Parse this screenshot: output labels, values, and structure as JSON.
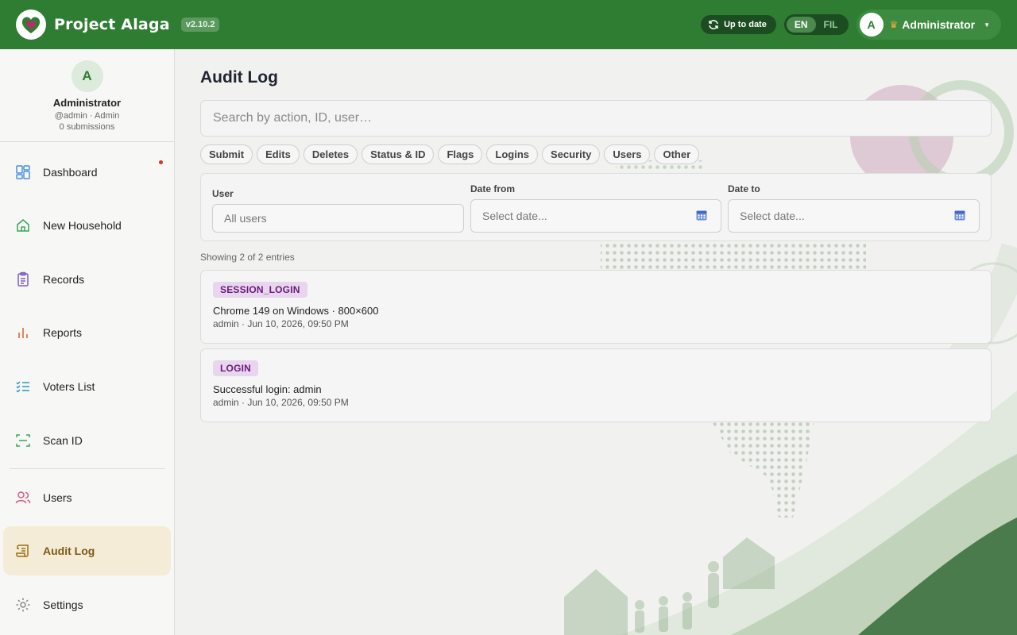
{
  "header": {
    "brand": "Project Alaga",
    "version": "v2.10.2",
    "sync_status": "Up to date",
    "lang_active": "EN",
    "lang_inactive": "FIL",
    "user_initial": "A",
    "user_name": "Administrator"
  },
  "sidebar": {
    "profile": {
      "initial": "A",
      "name": "Administrator",
      "handle": "@admin · Admin",
      "submissions": "0 submissions"
    },
    "items": [
      {
        "label": "Dashboard",
        "icon": "dashboard-icon",
        "color": "#4a90e2"
      },
      {
        "label": "New Household",
        "icon": "home-icon",
        "color": "#3aa65a"
      },
      {
        "label": "Records",
        "icon": "clipboard-icon",
        "color": "#7b5fc9"
      },
      {
        "label": "Reports",
        "icon": "bar-chart-icon",
        "color": "#e07a4d"
      },
      {
        "label": "Voters List",
        "icon": "checklist-icon",
        "color": "#2b9ab5"
      },
      {
        "label": "Scan ID",
        "icon": "scan-icon",
        "color": "#3aa65a"
      },
      {
        "label": "Users",
        "icon": "users-icon",
        "color": "#d9598a"
      },
      {
        "label": "Audit Log",
        "icon": "scroll-icon",
        "color": "#9a6d12"
      },
      {
        "label": "Settings",
        "icon": "gear-icon",
        "color": "#888888"
      }
    ],
    "active": "Audit Log"
  },
  "main": {
    "title": "Audit Log",
    "search_placeholder": "Search by action, ID, user…",
    "chips": [
      "Submit",
      "Edits",
      "Deletes",
      "Status & ID",
      "Flags",
      "Logins",
      "Security",
      "Users",
      "Other"
    ],
    "filters": {
      "user_label": "User",
      "user_value": "All users",
      "date_from_label": "Date from",
      "date_from_placeholder": "Select date...",
      "date_to_label": "Date to",
      "date_to_placeholder": "Select date..."
    },
    "count": "Showing 2 of 2 entries",
    "entries": [
      {
        "action": "SESSION_LOGIN",
        "detail": "Chrome 149 on Windows · 800×600",
        "meta": "admin · Jun 10, 2026, 09:50 PM"
      },
      {
        "action": "LOGIN",
        "detail": "Successful login: admin",
        "meta": "admin · Jun 10, 2026, 09:50 PM"
      }
    ]
  },
  "colors": {
    "header": "#2e7d32",
    "active_nav_bg": "#f5ecd7",
    "badge_bg": "#e8d5ee",
    "badge_text": "#6a1b7a"
  }
}
